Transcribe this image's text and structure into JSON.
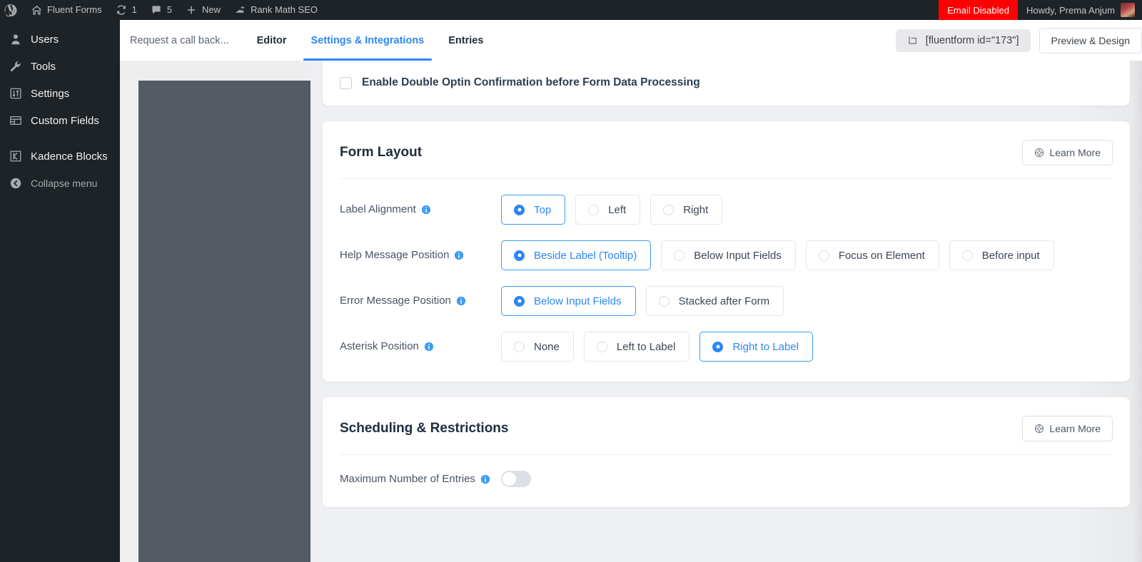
{
  "adminbar": {
    "wp_logo": "wordpress-logo-icon",
    "items": [
      {
        "icon": "home-icon",
        "label": "Fluent Forms"
      },
      {
        "icon": "updates-icon",
        "label": "1"
      },
      {
        "icon": "comment-icon",
        "label": "5"
      },
      {
        "icon": "plus-icon",
        "label": "New"
      },
      {
        "icon": "rank-math-icon",
        "label": "Rank Math SEO"
      }
    ],
    "email_disabled_label": "Email Disabled",
    "howdy_label": "Howdy, Prema Anjum",
    "avatar": "user-avatar"
  },
  "sidebar": {
    "items": [
      {
        "label": "Users",
        "icon": "users-icon"
      },
      {
        "label": "Tools",
        "icon": "tools-icon"
      },
      {
        "label": "Settings",
        "icon": "settings-icon"
      },
      {
        "label": "Custom Fields",
        "icon": "custom-fields-icon"
      },
      {
        "label": "Kadence Blocks",
        "icon": "kadence-blocks-icon"
      }
    ],
    "collapse_label": "Collapse menu",
    "collapse_icon": "collapse-arrow-icon"
  },
  "topbar": {
    "form_name": "Request a call back...",
    "tabs": [
      {
        "label": "Editor",
        "active": false
      },
      {
        "label": "Settings & Integrations",
        "active": true
      },
      {
        "label": "Entries",
        "active": false
      }
    ],
    "shortcode": "[fluentform id=\"173\"]",
    "shortcode_icon": "copy-shortcode-icon",
    "preview_button": "Preview & Design"
  },
  "optin": {
    "label": "Enable Double Optin Confirmation before Form Data Processing",
    "checked": false
  },
  "form_layout": {
    "title": "Form Layout",
    "learn_more": "Learn More",
    "learn_more_icon": "help-circle-icon",
    "rows": [
      {
        "label": "Label Alignment",
        "info_icon": "info-icon",
        "options": [
          {
            "label": "Top",
            "selected": true
          },
          {
            "label": "Left",
            "selected": false
          },
          {
            "label": "Right",
            "selected": false
          }
        ]
      },
      {
        "label": "Help Message Position",
        "info_icon": "info-icon",
        "options": [
          {
            "label": "Beside Label (Tooltip)",
            "selected": true
          },
          {
            "label": "Below Input Fields",
            "selected": false
          },
          {
            "label": "Focus on Element",
            "selected": false
          },
          {
            "label": "Before input",
            "selected": false
          }
        ]
      },
      {
        "label": "Error Message Position",
        "info_icon": "info-icon",
        "options": [
          {
            "label": "Below Input Fields",
            "selected": true
          },
          {
            "label": "Stacked after Form",
            "selected": false
          }
        ]
      },
      {
        "label": "Asterisk Position",
        "info_icon": "info-icon",
        "options": [
          {
            "label": "None",
            "selected": false
          },
          {
            "label": "Left to Label",
            "selected": false
          },
          {
            "label": "Right to Label",
            "selected": true
          }
        ]
      }
    ]
  },
  "scheduling": {
    "title": "Scheduling & Restrictions",
    "learn_more": "Learn More",
    "learn_more_icon": "help-circle-icon",
    "max_entries_label": "Maximum Number of Entries",
    "max_entries_info_icon": "info-icon",
    "max_entries_enabled": false
  },
  "colors": {
    "accent": "#2b87f5",
    "admin_dark": "#1d2327",
    "danger": "#ff0000",
    "panel_dark": "#545b64"
  }
}
